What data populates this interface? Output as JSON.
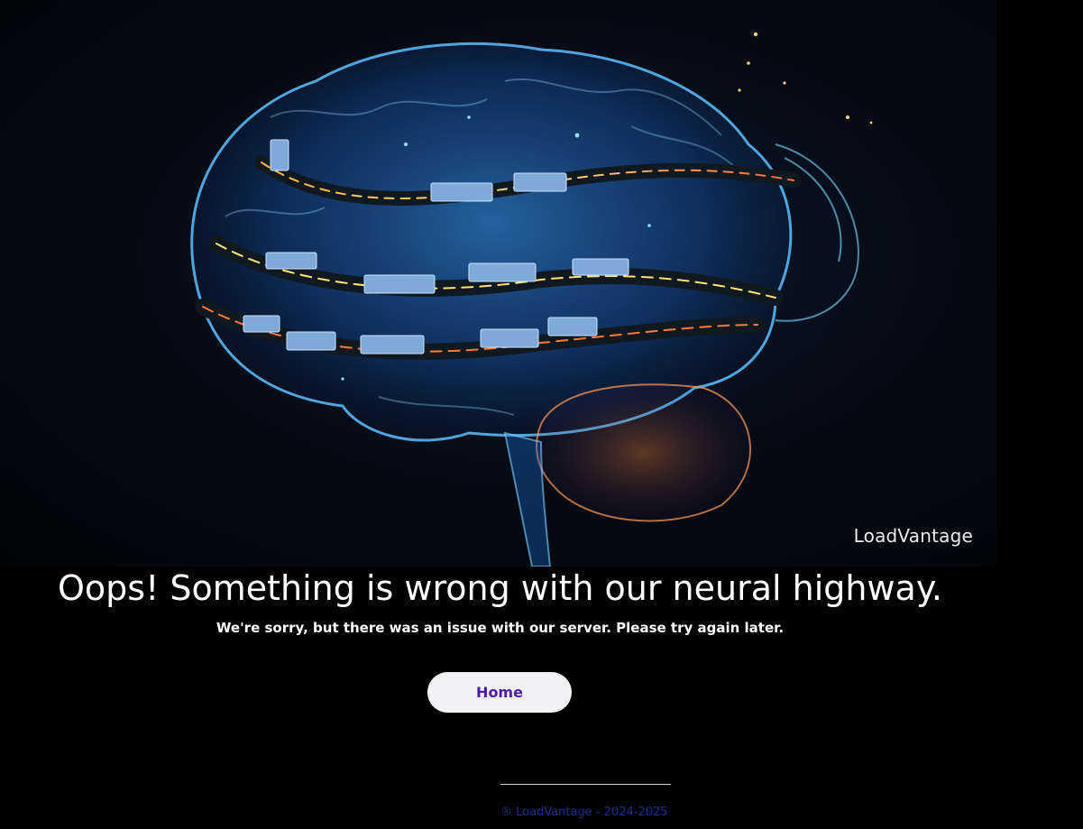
{
  "hero": {
    "watermark": "LoadVantage"
  },
  "error": {
    "headline": "Oops! Something is wrong with our neural highway.",
    "message": "We're sorry, but there was an issue with our server. Please try again later."
  },
  "actions": {
    "home_label": "Home"
  },
  "footer": {
    "copyright_icon": "copyright-icon",
    "copyright_text": "® LoadVantage - 2024-2025"
  },
  "colors": {
    "background": "#000000",
    "button_bg": "#f2f1f4",
    "button_text": "#4a1aa8",
    "footer_text": "#1f2e8c",
    "brain_glow": "#3aa0ff"
  }
}
